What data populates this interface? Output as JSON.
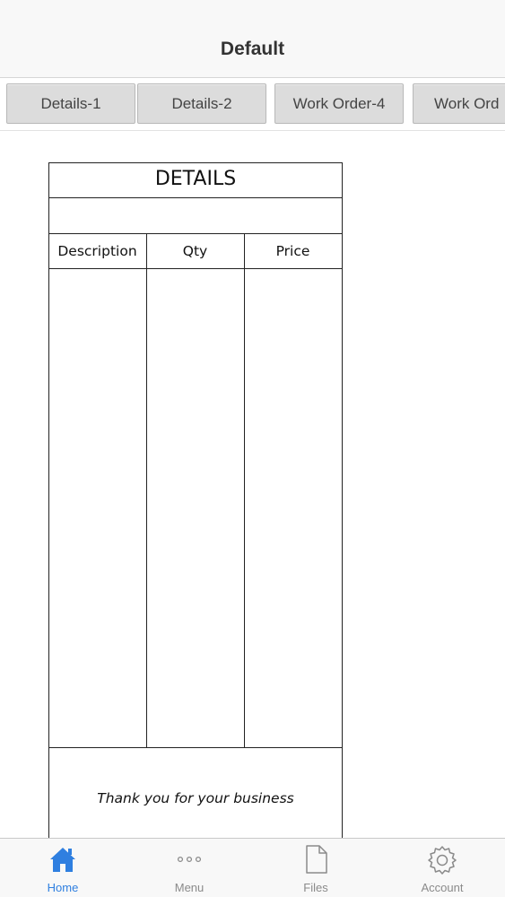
{
  "navbar": {
    "title": "Default"
  },
  "tabs": [
    {
      "label": "Details-1"
    },
    {
      "label": "Details-2"
    },
    {
      "label": "Work Order-4"
    },
    {
      "label": "Work Ord"
    }
  ],
  "document": {
    "title": "DETAILS",
    "columns": [
      "Description",
      "Qty",
      "Price"
    ],
    "footer_note": "Thank you for your business"
  },
  "tabbar": {
    "items": [
      {
        "label": "Home",
        "icon": "home-icon",
        "active": true
      },
      {
        "label": "Menu",
        "icon": "more-icon",
        "active": false
      },
      {
        "label": "Files",
        "icon": "file-icon",
        "active": false
      },
      {
        "label": "Account",
        "icon": "gear-icon",
        "active": false
      }
    ]
  },
  "colors": {
    "accent": "#2f7fe0",
    "inactive": "#8a8a8a",
    "bar_bg": "#f8f8f8"
  }
}
